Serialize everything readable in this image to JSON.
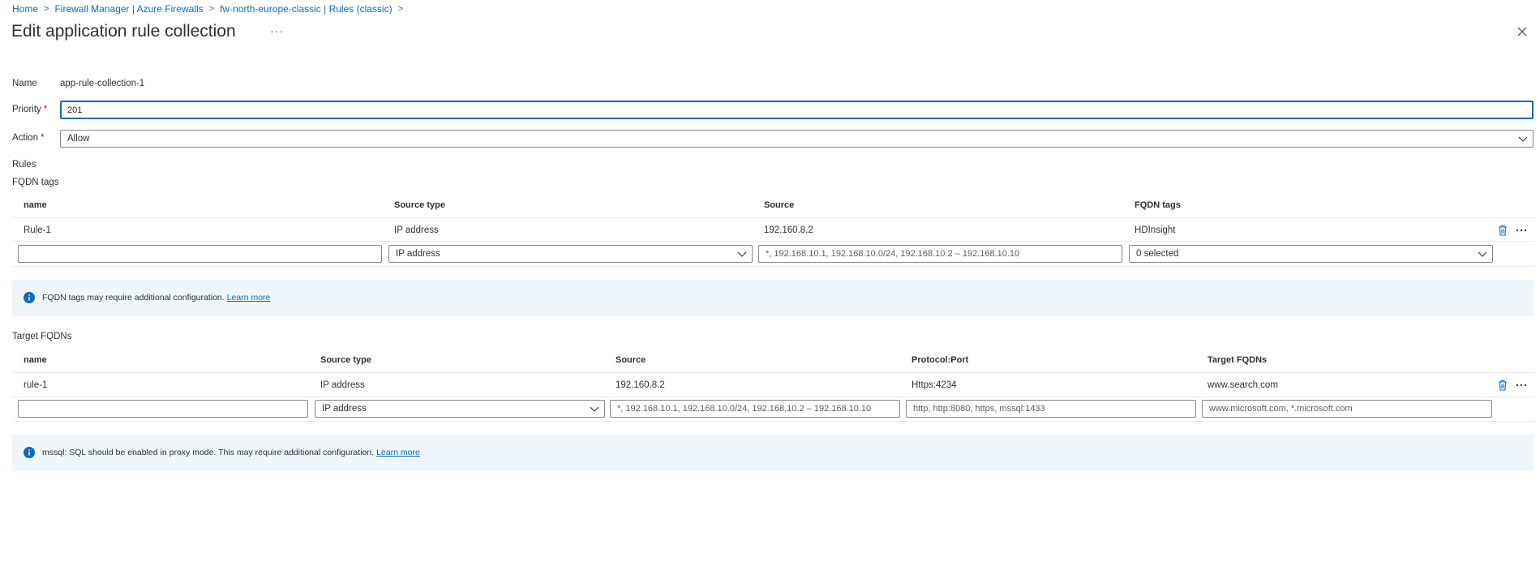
{
  "breadcrumb": [
    "Home",
    "Firewall Manager | Azure Firewalls",
    "fw-north-europe-classic | Rules (classic)"
  ],
  "title": "Edit application rule collection",
  "more_glyph": "···",
  "form": {
    "name_label": "Name",
    "name_value": "app-rule-collection-1",
    "priority_label": "Priority",
    "priority_value": "201",
    "action_label": "Action",
    "action_value": "Allow",
    "required_mark": "*"
  },
  "rules_heading": "Rules",
  "fqdn_tags": {
    "heading": "FQDN tags",
    "columns": [
      "name",
      "Source type",
      "Source",
      "FQDN tags"
    ],
    "rows": [
      {
        "name": "Rule-1",
        "source_type": "IP address",
        "source": "192.160.8.2",
        "fqdn_tags": "HDInsight"
      }
    ],
    "new_row": {
      "name_value": "",
      "source_type": "IP address",
      "source_placeholder": "*, 192.168.10.1, 192.168.10.0/24, 192.168.10.2 – 192.168.10.10",
      "fqdn_tags": "0 selected"
    },
    "info": {
      "text": "FQDN tags may require additional configuration.",
      "link": "Learn more"
    }
  },
  "target_fqdns": {
    "heading": "Target FQDNs",
    "columns": [
      "name",
      "Source type",
      "Source",
      "Protocol:Port",
      "Target FQDNs"
    ],
    "rows": [
      {
        "name": "rule-1",
        "source_type": "IP address",
        "source": "192.160.8.2",
        "protocol_port": "Https:4234",
        "target_fqdns": "www.search.com"
      }
    ],
    "new_row": {
      "name_value": "",
      "source_type": "IP address",
      "source_placeholder": "*, 192.168.10.1, 192.168.10.0/24, 192.168.10.2 – 192.168.10.10",
      "protocol_placeholder": "http, http:8080, https, mssql:1433",
      "target_placeholder": "www.microsoft.com, *.microsoft.com"
    },
    "info": {
      "text": "mssql: SQL should be enabled in proxy mode. This may require additional configuration.",
      "link": "Learn more"
    }
  },
  "colors": {
    "accent": "#0f6cbd",
    "info_bg": "#eff6fc",
    "required": "#a4262c"
  }
}
